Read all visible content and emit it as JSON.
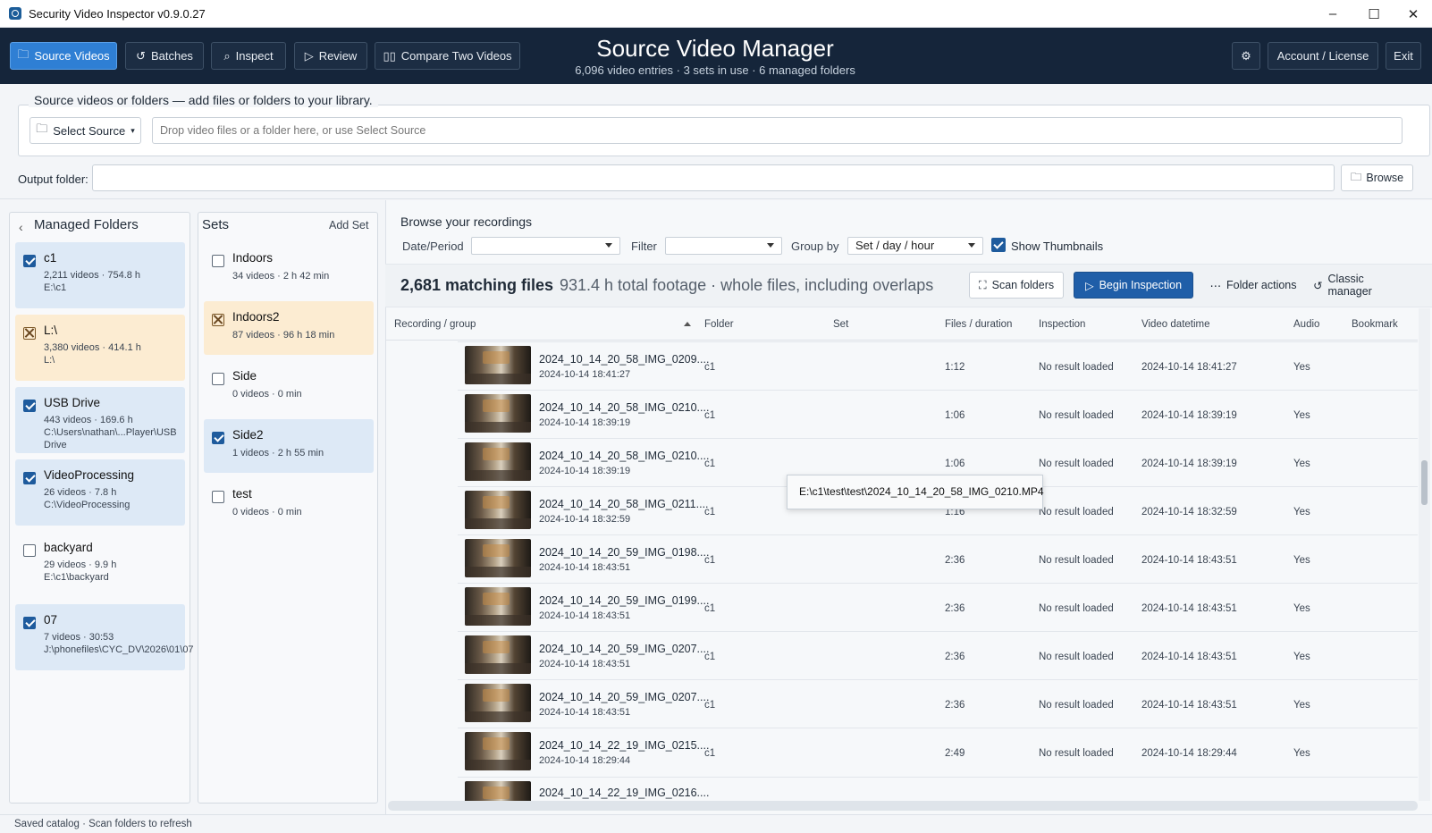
{
  "window": {
    "title": "Security Video Inspector v0.9.0.27",
    "minimize": "–",
    "maximize": "☐",
    "close": "✕"
  },
  "nav": {
    "source_videos": "Source Videos",
    "batches": "Batches",
    "inspect": "Inspect",
    "review": "Review",
    "compare": "Compare Two Videos",
    "account": "Account / License",
    "exit": "Exit"
  },
  "header": {
    "title": "Source Video Manager",
    "subtitle": "6,096 video entries · 3 sets in use · 6 managed folders"
  },
  "source": {
    "legend": "Source videos or folders — add files or folders to your library.",
    "select_label": "Select Source",
    "drop_placeholder": "Drop video files or a folder here, or use Select Source",
    "output_label": "Output folder:",
    "output_value": "",
    "browse_label": "Browse"
  },
  "folders": {
    "title": "Managed Folders",
    "items": [
      {
        "name": "c1",
        "meta": "2,211 videos · 754.8 h",
        "path": "E:\\c1",
        "state": "checked"
      },
      {
        "name": "L:\\",
        "meta": "3,380 videos · 414.1 h",
        "path": "L:\\",
        "state": "mixed"
      },
      {
        "name": "USB Drive",
        "meta": "443 videos · 169.6 h",
        "path": "C:\\Users\\nathan\\...Player\\USB Drive",
        "state": "checked"
      },
      {
        "name": "VideoProcessing",
        "meta": "26 videos · 7.8 h",
        "path": "C:\\VideoProcessing",
        "state": "checked"
      },
      {
        "name": "backyard",
        "meta": "29 videos · 9.9 h",
        "path": "E:\\c1\\backyard",
        "state": "unchecked"
      },
      {
        "name": "07",
        "meta": "7 videos · 30:53",
        "path": "J:\\phonefiles\\CYC_DV\\2026\\01\\07",
        "state": "checked"
      }
    ]
  },
  "sets": {
    "title": "Sets",
    "add_label": "Add Set",
    "items": [
      {
        "name": "Indoors",
        "meta": "34 videos · 2 h 42 min",
        "state": "unchecked"
      },
      {
        "name": "Indoors2",
        "meta": "87 videos · 96 h 18 min",
        "state": "mixed"
      },
      {
        "name": "Side",
        "meta": "0 videos · 0 min",
        "state": "unchecked"
      },
      {
        "name": "Side2",
        "meta": "1 videos · 2 h 55 min",
        "state": "checked"
      },
      {
        "name": "test",
        "meta": "0 videos · 0 min",
        "state": "unchecked"
      }
    ]
  },
  "browse": {
    "title": "Browse your recordings",
    "date_label": "Date/Period",
    "date_value": "",
    "filter_label": "Filter",
    "filter_value": "",
    "groupby_label": "Group by",
    "groupby_value": "Set / day / hour",
    "thumbnails_label": "Show Thumbnails",
    "thumbnails_checked": true
  },
  "summary": {
    "count": "2,681 matching files",
    "footage": "931.4 h total footage · whole files, including overlaps",
    "scan": "Scan folders",
    "begin": "Begin Inspection",
    "folder_actions": "Folder actions",
    "classic": "Classic manager"
  },
  "table": {
    "headers": [
      "Recording / group",
      "Folder",
      "Set",
      "Files / duration",
      "Inspection",
      "Video datetime",
      "Audio",
      "Bookmark"
    ],
    "rows": [
      {
        "name": "2024_10_14_20_58_IMG_0209....",
        "date": "2024-10-14 18:41:27",
        "folder": "c1",
        "set": "",
        "duration": "1:12",
        "inspection": "No result loaded",
        "datetime": "2024-10-14 18:41:27",
        "audio": "Yes"
      },
      {
        "name": "2024_10_14_20_58_IMG_0210....",
        "date": "2024-10-14 18:39:19",
        "folder": "c1",
        "set": "",
        "duration": "1:06",
        "inspection": "No result loaded",
        "datetime": "2024-10-14 18:39:19",
        "audio": "Yes"
      },
      {
        "name": "2024_10_14_20_58_IMG_0210....",
        "date": "2024-10-14 18:39:19",
        "folder": "c1",
        "set": "",
        "duration": "1:06",
        "inspection": "No result loaded",
        "datetime": "2024-10-14 18:39:19",
        "audio": "Yes"
      },
      {
        "name": "2024_10_14_20_58_IMG_0211....",
        "date": "2024-10-14 18:32:59",
        "folder": "c1",
        "set": "",
        "duration": "1:16",
        "inspection": "No result loaded",
        "datetime": "2024-10-14 18:32:59",
        "audio": "Yes"
      },
      {
        "name": "2024_10_14_20_59_IMG_0198....",
        "date": "2024-10-14 18:43:51",
        "folder": "c1",
        "set": "",
        "duration": "2:36",
        "inspection": "No result loaded",
        "datetime": "2024-10-14 18:43:51",
        "audio": "Yes"
      },
      {
        "name": "2024_10_14_20_59_IMG_0199....",
        "date": "2024-10-14 18:43:51",
        "folder": "c1",
        "set": "",
        "duration": "2:36",
        "inspection": "No result loaded",
        "datetime": "2024-10-14 18:43:51",
        "audio": "Yes"
      },
      {
        "name": "2024_10_14_20_59_IMG_0207....",
        "date": "2024-10-14 18:43:51",
        "folder": "c1",
        "set": "",
        "duration": "2:36",
        "inspection": "No result loaded",
        "datetime": "2024-10-14 18:43:51",
        "audio": "Yes"
      },
      {
        "name": "2024_10_14_20_59_IMG_0207....",
        "date": "2024-10-14 18:43:51",
        "folder": "c1",
        "set": "",
        "duration": "2:36",
        "inspection": "No result loaded",
        "datetime": "2024-10-14 18:43:51",
        "audio": "Yes"
      },
      {
        "name": "2024_10_14_22_19_IMG_0215....",
        "date": "2024-10-14 18:29:44",
        "folder": "c1",
        "set": "",
        "duration": "2:49",
        "inspection": "No result loaded",
        "datetime": "2024-10-14 18:29:44",
        "audio": "Yes"
      }
    ],
    "partial_row": {
      "name": "2024_10_14_22_19_IMG_0216...."
    }
  },
  "tooltip": "E:\\c1\\test\\test\\2024_10_14_20_58_IMG_0210.MP4",
  "status": "Saved catalog · Scan folders to refresh",
  "colors": {
    "header_bg": "#15253a",
    "accent": "#2f7fd4",
    "primary": "#1f5ea8",
    "selected_bg": "#dde9f6",
    "warn_bg": "#fcecd2"
  }
}
